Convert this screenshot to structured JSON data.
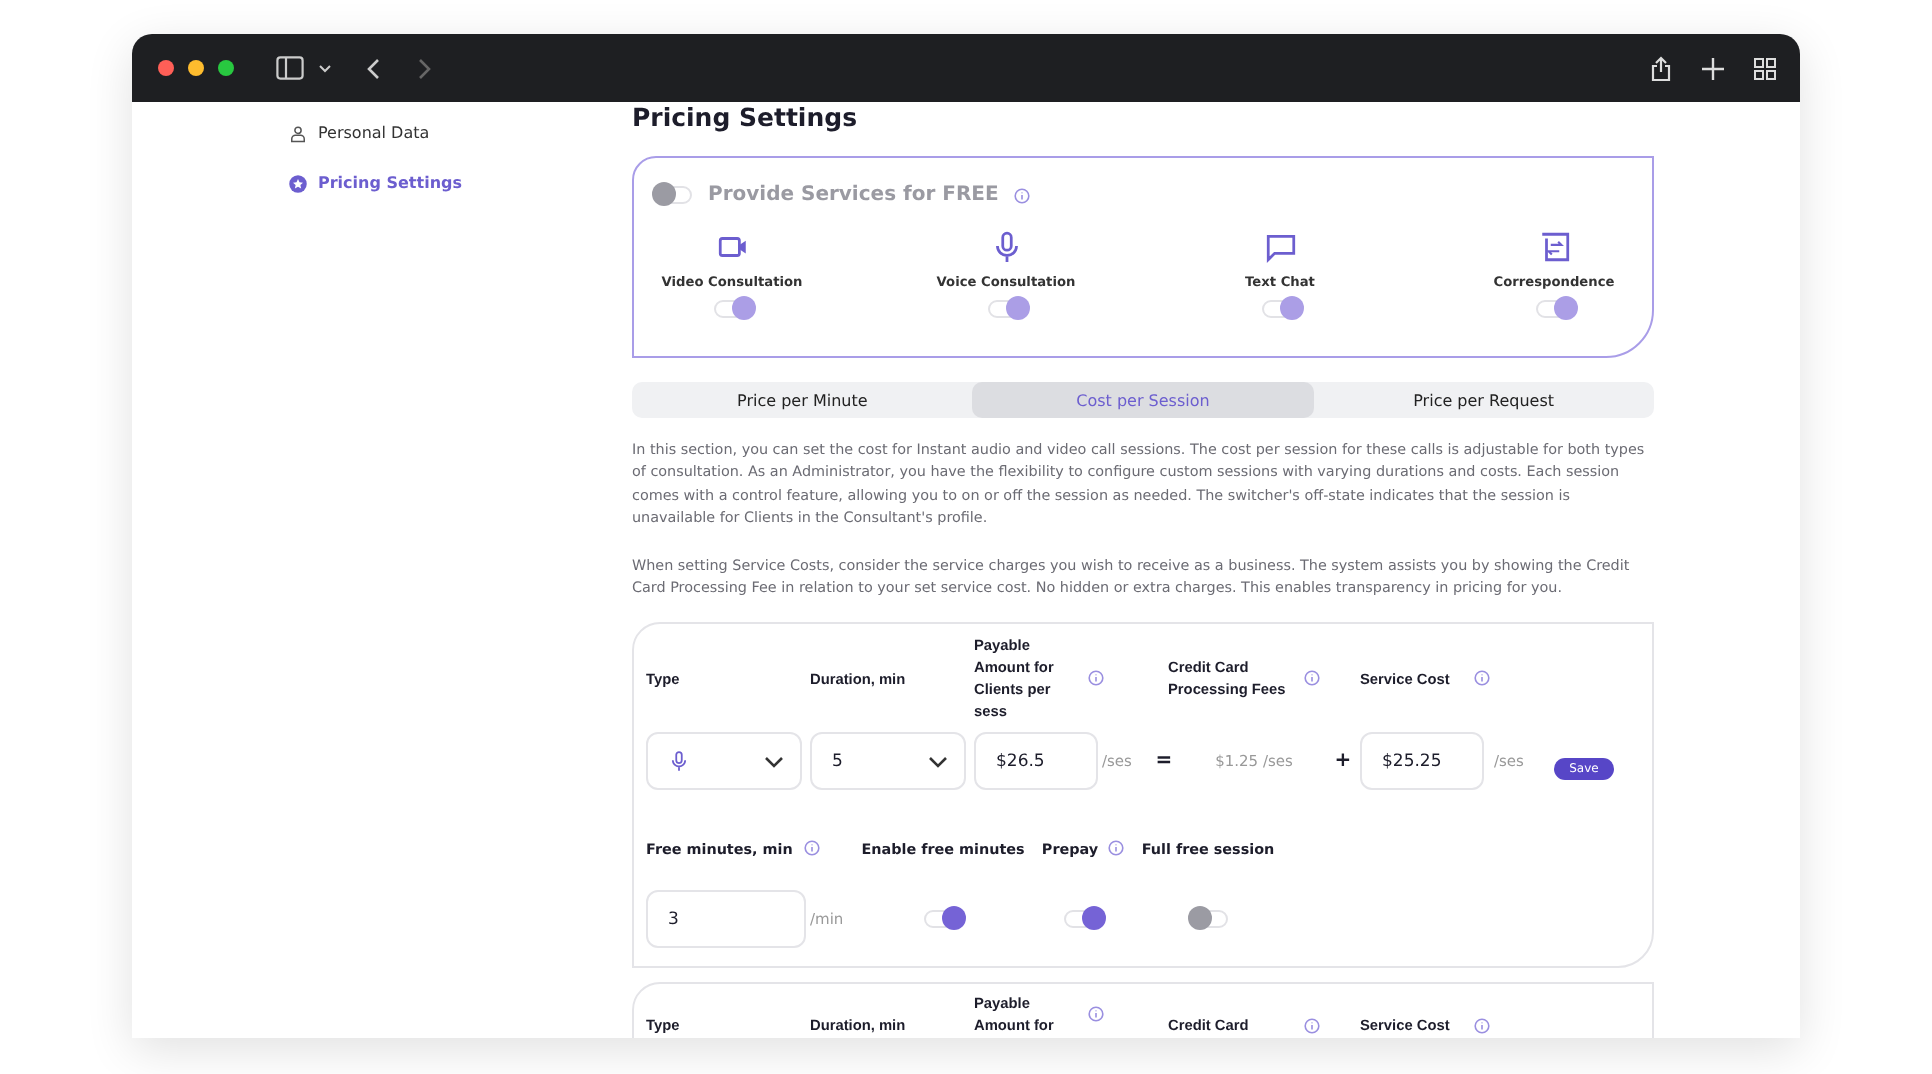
{
  "sidebar": {
    "items": [
      {
        "label": "Personal Data",
        "selected": false
      },
      {
        "label": "Pricing Settings",
        "selected": true
      }
    ]
  },
  "page_title": "Pricing Settings",
  "free_services": {
    "label": "Provide Services for FREE",
    "on": false,
    "services": [
      {
        "label": "Video Consultation",
        "on": true
      },
      {
        "label": "Voice Consultation",
        "on": true
      },
      {
        "label": "Text Chat",
        "on": true
      },
      {
        "label": "Correspondence",
        "on": true
      }
    ]
  },
  "tabs": [
    {
      "label": "Price per Minute",
      "selected": false
    },
    {
      "label": "Cost per Session",
      "selected": true
    },
    {
      "label": "Price per Request",
      "selected": false
    }
  ],
  "description": [
    "In this section, you can set the cost for Instant audio and video call sessions. The cost per session for these calls is adjustable for both types of consultation. As an Administrator, you have the flexibility to configure custom sessions with varying durations and costs. Each session comes with a control feature, allowing you to on or off the session as needed. The switcher's off-state indicates that the session is unavailable for Clients in the Consultant's profile.",
    "When setting Service Costs, consider the service charges you wish to receive as a business. The system assists you by showing the Credit Card Processing Fee in relation to your set service cost. No hidden or extra charges. This enables transparency in pricing for you."
  ],
  "sessions": [
    {
      "columns": [
        {
          "label": "Type",
          "info": false
        },
        {
          "label": "Duration, min",
          "info": false
        },
        {
          "label": "Payable Amount for Clients per sess",
          "info": true
        },
        {
          "label": "Credit Card Processing Fees",
          "info": true
        },
        {
          "label": "Service Cost",
          "info": true
        }
      ],
      "row": {
        "duration": "5",
        "payable": "$26.5",
        "payable_unit": "/ses",
        "equals": "=",
        "fee": "$1.25 /ses",
        "plus": "+",
        "service_cost": "$25.25",
        "service_unit": "/ses",
        "save": "Save"
      },
      "options": [
        {
          "kind": "input",
          "label": "Free minutes, min",
          "info": true,
          "value": "3",
          "unit": "/min"
        },
        {
          "kind": "toggle",
          "label": "Enable free minutes",
          "info": false,
          "on": true
        },
        {
          "kind": "toggle",
          "label": "Prepay",
          "info": true,
          "on": true
        },
        {
          "kind": "toggle",
          "label": "Full free session",
          "info": false,
          "on": false
        }
      ]
    },
    {
      "columns": [
        {
          "label": "Type",
          "info": false
        },
        {
          "label": "Duration, min",
          "info": false
        },
        {
          "label": "Payable Amount for",
          "info": true
        },
        {
          "label": "Credit Card",
          "info": true
        },
        {
          "label": "Service Cost",
          "info": true
        }
      ]
    }
  ]
}
